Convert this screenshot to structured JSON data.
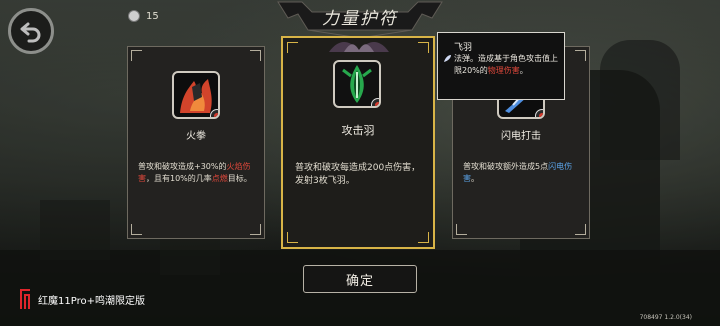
{
  "header": {
    "title": "力量护符",
    "coin_count": "15"
  },
  "cards": [
    {
      "name": "火拳",
      "icon": "fire-fist-icon",
      "desc_parts": [
        "普攻和破攻造成+30%的",
        "火焰伤害",
        "，且有10%的几率",
        "点燃",
        "目标。"
      ]
    },
    {
      "name": "攻击羽",
      "icon": "attack-feather-icon",
      "desc": "普攻和破攻每造成200点伤害，发射3枚飞羽。"
    },
    {
      "name": "闪电打击",
      "icon": "lightning-strike-icon",
      "desc_parts": [
        "普攻和破攻额外造成5点",
        "闪电伤害",
        "。"
      ]
    }
  ],
  "tooltip": {
    "title": "飞羽",
    "body_parts": [
      "法弹。造成基于角色攻击值上限20%的",
      "物理伤害",
      "。"
    ]
  },
  "buttons": {
    "confirm": "确定"
  },
  "footer": {
    "brand": "红魔11Pro+鸣潮限定版",
    "version": "708497 1.2.0(34)"
  },
  "colors": {
    "selected_border": "#d8b447",
    "fire_damage_text": "#e0483b",
    "lightning_damage_text": "#5aa2e6"
  }
}
